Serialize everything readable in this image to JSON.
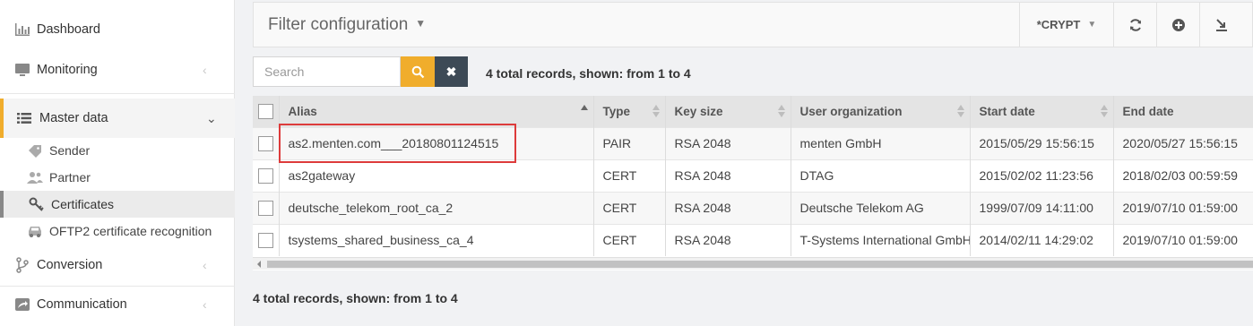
{
  "sidebar": {
    "items": [
      {
        "label": "Dashboard",
        "icon": "bar-chart-icon"
      },
      {
        "label": "Monitoring",
        "icon": "monitor-icon"
      },
      {
        "label": "Master data",
        "icon": "list-icon",
        "active": true
      },
      {
        "label": "Conversion",
        "icon": "branch-icon"
      },
      {
        "label": "Communication",
        "icon": "share-icon"
      }
    ],
    "subitems": [
      {
        "label": "Sender",
        "icon": "tag-icon"
      },
      {
        "label": "Partner",
        "icon": "users-icon"
      },
      {
        "label": "Certificates",
        "icon": "key-icon",
        "selected": true
      },
      {
        "label": "OFTP2 certificate recognition",
        "icon": "car-icon"
      }
    ]
  },
  "header": {
    "filter_title": "Filter configuration",
    "crypt_label": "*CRYPT"
  },
  "search": {
    "placeholder": "Search",
    "value": ""
  },
  "records_text": "4 total records, shown: from 1 to 4",
  "table": {
    "columns": [
      "Alias",
      "Type",
      "Key size",
      "User organization",
      "Start date",
      "End date"
    ],
    "rows": [
      [
        "as2.menten.com___20180801124515",
        "PAIR",
        "RSA 2048",
        "menten GmbH",
        "2015/05/29 15:56:15",
        "2020/05/27 15:56:15"
      ],
      [
        "as2gateway",
        "CERT",
        "RSA 2048",
        "DTAG",
        "2015/02/02 11:23:56",
        "2018/02/03 00:59:59"
      ],
      [
        "deutsche_telekom_root_ca_2",
        "CERT",
        "RSA 2048",
        "Deutsche Telekom AG",
        "1999/07/09 14:11:00",
        "2019/07/10 01:59:00"
      ],
      [
        "tsystems_shared_business_ca_4",
        "CERT",
        "RSA 2048",
        "T-Systems International GmbH",
        "2014/02/11 14:29:02",
        "2019/07/10 01:59:00"
      ]
    ]
  },
  "colors": {
    "accent": "#f0ad2c",
    "dark_button": "#3d4a56",
    "highlight": "#dd3b3b"
  }
}
